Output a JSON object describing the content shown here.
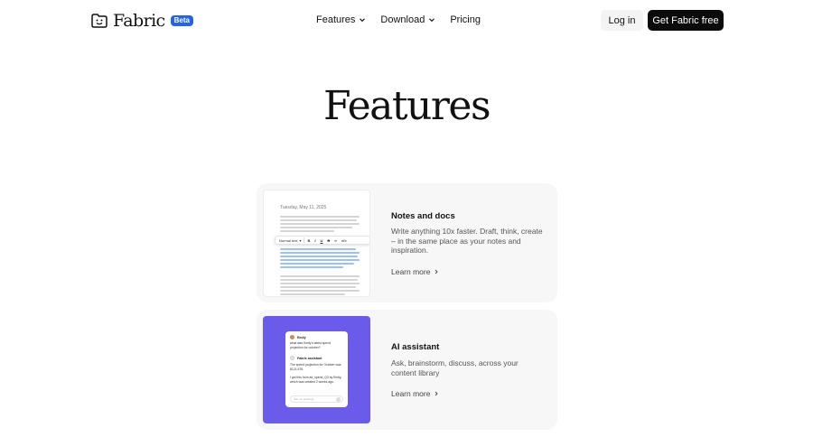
{
  "brand": {
    "name": "Fabric",
    "badge": "Beta"
  },
  "nav": {
    "items": [
      {
        "label": "Features",
        "has_dropdown": true
      },
      {
        "label": "Download",
        "has_dropdown": true
      },
      {
        "label": "Pricing",
        "has_dropdown": false
      }
    ],
    "login_label": "Log in",
    "cta_label": "Get Fabric free"
  },
  "hero": {
    "title": "Features"
  },
  "features": [
    {
      "title": "Notes and docs",
      "description": "Write anything 10x faster. Draft, think, create – in the same place as your notes and inspiration.",
      "link_label": "Learn more",
      "thumbnail": {
        "date": "Tuesday, May 11, 2025",
        "toolbar_style": "Normal text"
      }
    },
    {
      "title": "AI assistant",
      "description": "Ask, brainstorm, discuss, across your content library",
      "link_label": "Learn more",
      "thumbnail": {
        "user_name": "Emily",
        "question": "what was Emily's latest spend projection for october?",
        "assistant_name": "Fabric assistant",
        "answer": "The spend projection for October was $121,578.",
        "source": "I got this from ad_spend_Q3 by Emily, which was created 2 weeks ago.",
        "input_placeholder": "Ask me anything..."
      }
    }
  ],
  "colors": {
    "beta_badge": "#2563eb",
    "cta_background": "#0b0b0b",
    "card_background": "#f7f7f7",
    "ai_thumbnail": "#6b5bea",
    "highlight": "#9cc0f7"
  }
}
